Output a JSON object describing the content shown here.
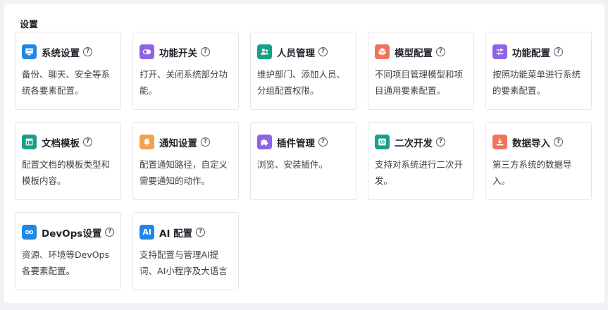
{
  "section": {
    "title": "设置"
  },
  "cards": [
    {
      "title": "系统设置",
      "desc": "备份、聊天、安全等系统各要素配置。",
      "color": "#1e88e5",
      "icon": "monitor-icon"
    },
    {
      "title": "功能开关",
      "desc": "打开、关闭系统部分功能。",
      "color": "#8e63e6",
      "icon": "toggle-icon"
    },
    {
      "title": "人员管理",
      "desc": "维护部门、添加人员、分组配置权限。",
      "color": "#16a085",
      "icon": "users-icon"
    },
    {
      "title": "模型配置",
      "desc": "不同项目管理模型和项目通用要素配置。",
      "color": "#f0735c",
      "icon": "cube-icon"
    },
    {
      "title": "功能配置",
      "desc": "按照功能菜单进行系统的要素配置。",
      "color": "#8e63e6",
      "icon": "sliders-icon"
    },
    {
      "title": "文档模板",
      "desc": "配置文档的模板类型和模板内容。",
      "color": "#16a085",
      "icon": "layout-icon"
    },
    {
      "title": "通知设置",
      "desc": "配置通知路径，自定义需要通知的动作。",
      "color": "#f5a04a",
      "icon": "bell-icon"
    },
    {
      "title": "插件管理",
      "desc": "浏览、安装插件。",
      "color": "#8e63e6",
      "icon": "puzzle-icon"
    },
    {
      "title": "二次开发",
      "desc": "支持对系统进行二次开发。",
      "color": "#16a085",
      "icon": "code-icon"
    },
    {
      "title": "数据导入",
      "desc": "第三方系统的数据导入。",
      "color": "#f0735c",
      "icon": "download-icon"
    },
    {
      "title": "DevOps设置",
      "desc": "资源、环境等DevOps各要素配置。",
      "color": "#1e88e5",
      "icon": "infinity-icon"
    },
    {
      "title": "AI 配置",
      "desc": "支持配置与管理AI提词、AI小程序及大语言",
      "color": "#1e88e5",
      "icon": "ai-icon",
      "icon_text": "AI"
    }
  ],
  "help_glyph": "?"
}
